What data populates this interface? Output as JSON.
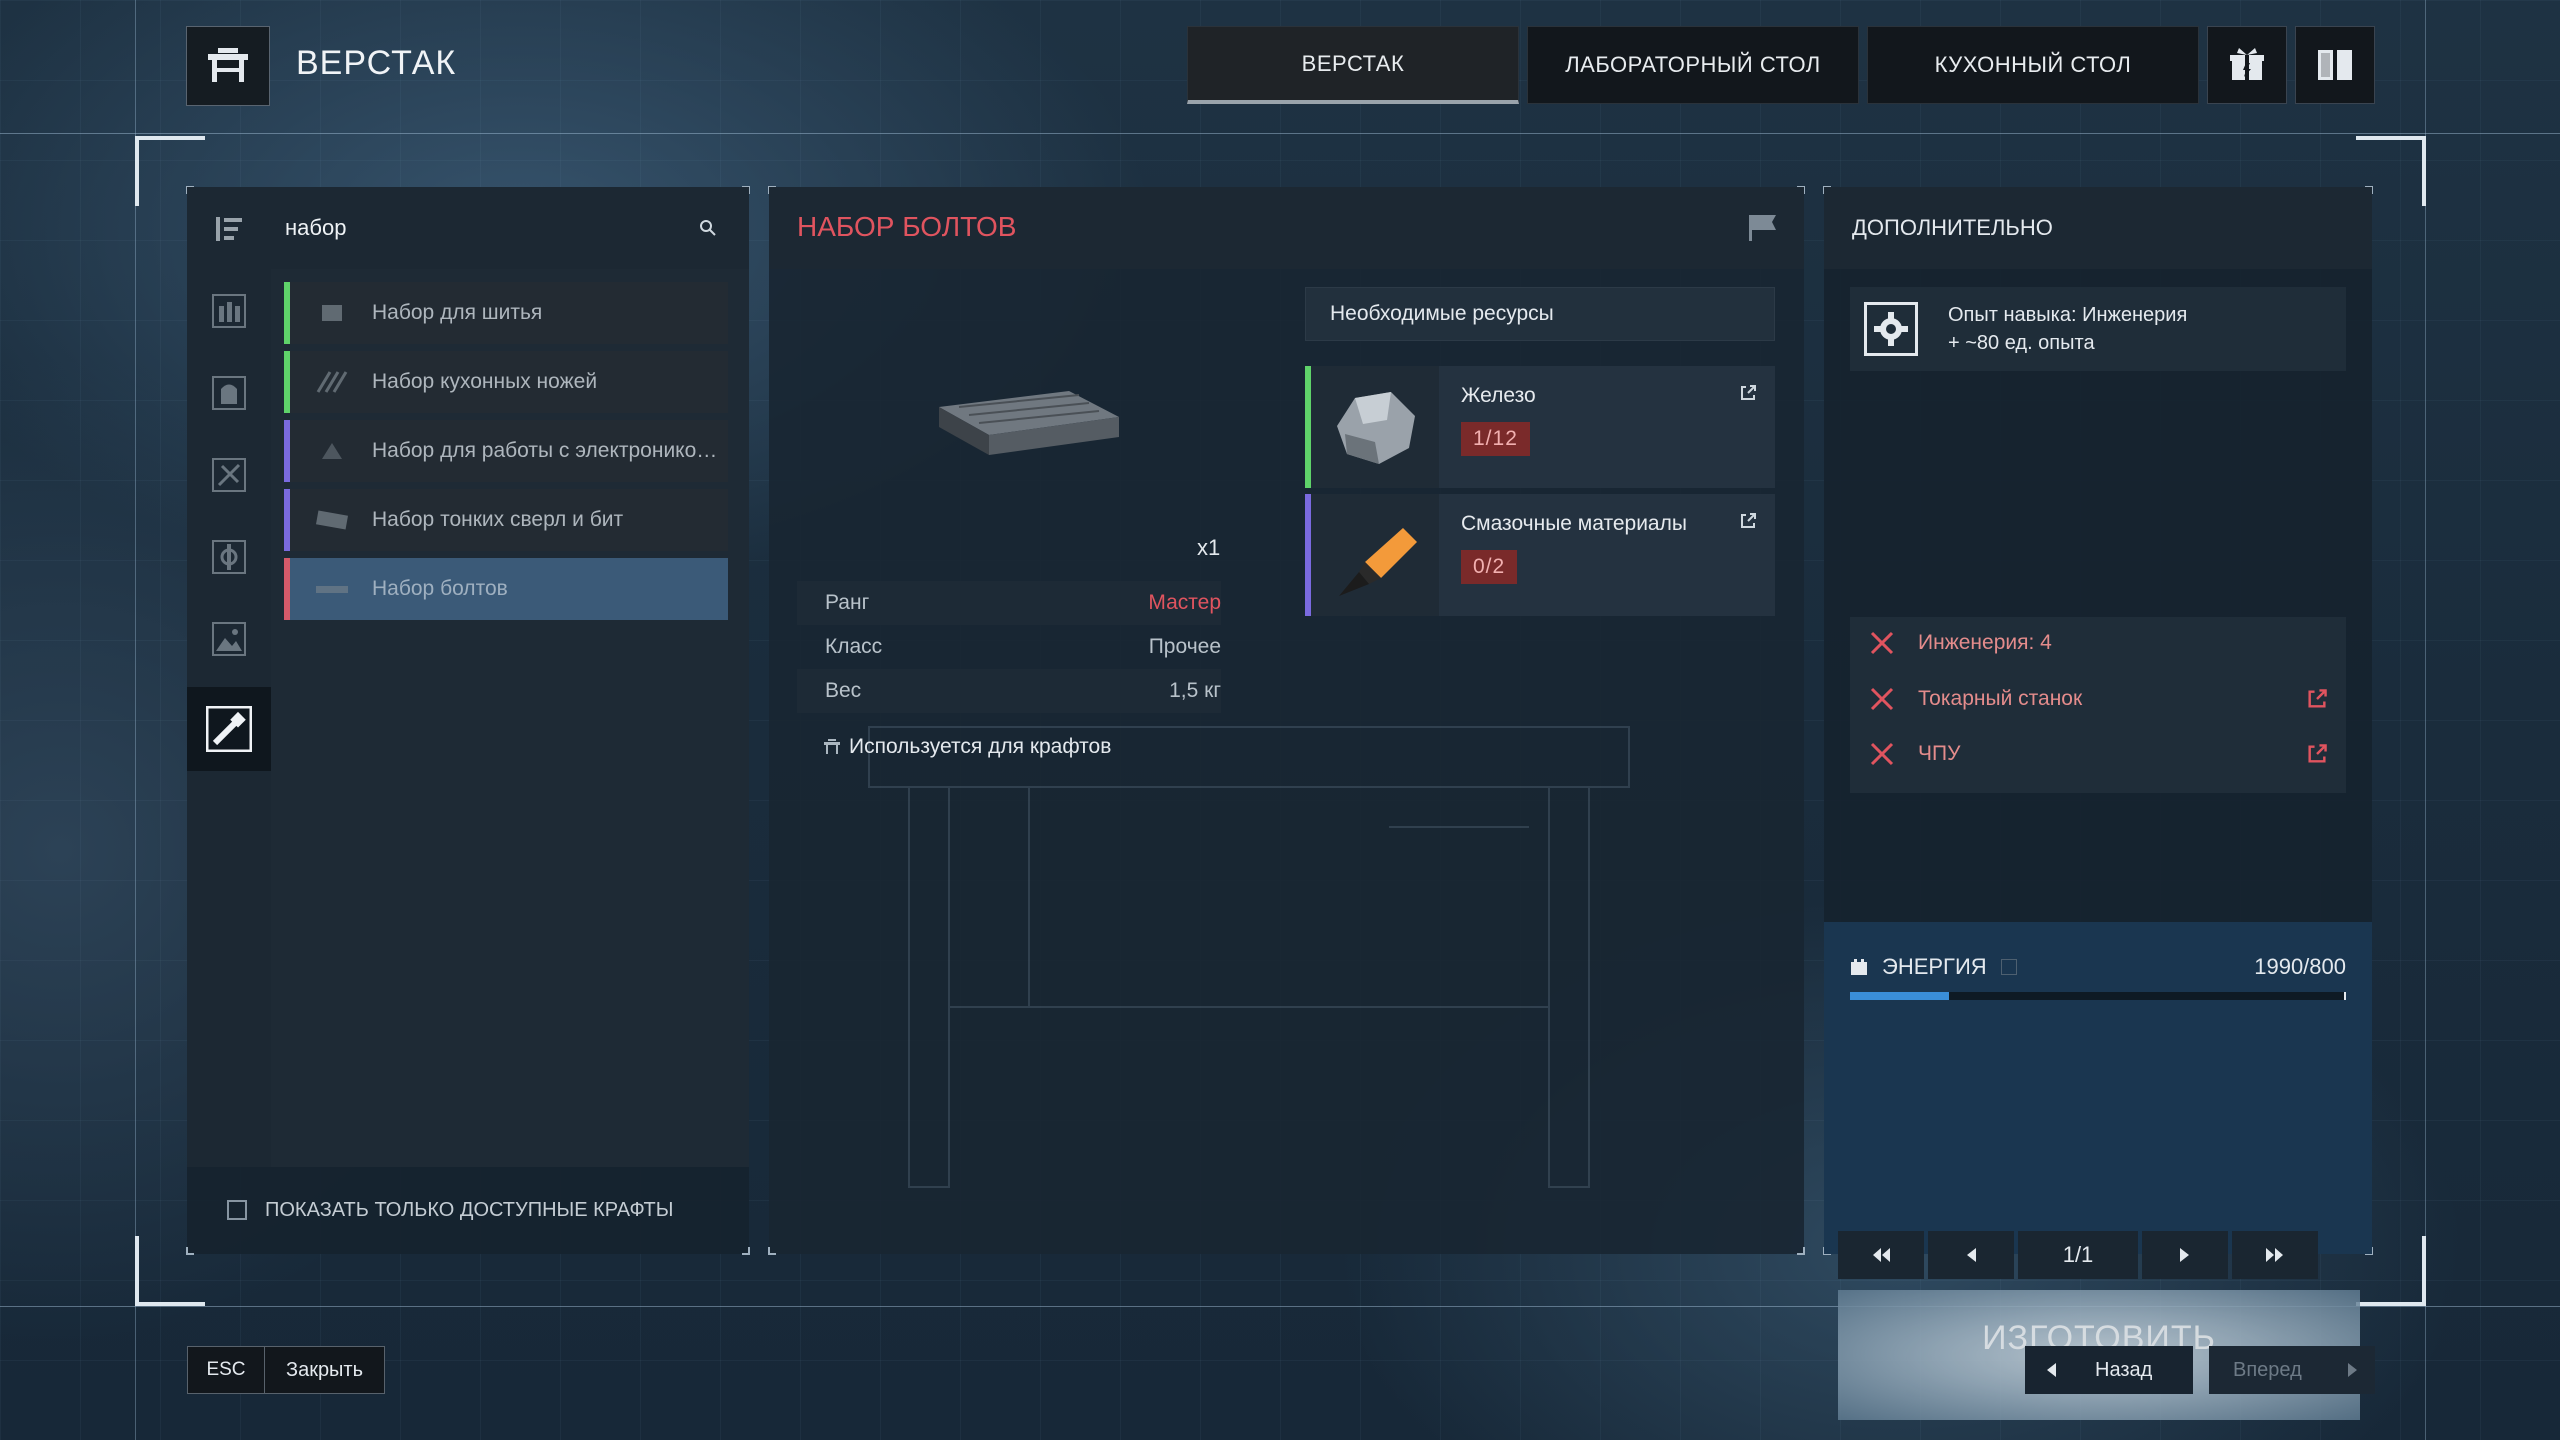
{
  "header": {
    "title": "ВЕРСТАК",
    "tabs": [
      "ВЕРСТАК",
      "ЛАБОРАТОРНЫЙ СТОЛ",
      "КУХОННЫЙ СТОЛ"
    ],
    "active_tab": 0
  },
  "left": {
    "search_value": "набор",
    "items": [
      {
        "label": "Набор для шитья",
        "bar_color": "#5fd36a"
      },
      {
        "label": "Набор кухонных ножей",
        "bar_color": "#5fd36a"
      },
      {
        "label": "Набор для работы с электроникой…",
        "bar_color": "#7a6adf"
      },
      {
        "label": "Набор тонких сверл и бит",
        "bar_color": "#7a6adf"
      },
      {
        "label": "Набор болтов",
        "bar_color": "#d55a6a"
      }
    ],
    "selected_index": 4,
    "filter_label": "ПОКАЗАТЬ ТОЛЬКО ДОСТУПНЫЕ КРАФТЫ",
    "filter_checked": false
  },
  "center": {
    "title": "НАБОР БОЛТОВ",
    "quantity": "x1",
    "stats": [
      {
        "label": "Ранг",
        "value": "Мастер"
      },
      {
        "label": "Класс",
        "value": "Прочее"
      },
      {
        "label": "Вес",
        "value": "1,5 кг"
      }
    ],
    "used_for": "Используется для крафтов",
    "resources_header": "Необходимые ресурсы",
    "resources": [
      {
        "name": "Железо",
        "count": "1/12",
        "bar_color": "#5fd36a",
        "icon": "iron-ore-icon"
      },
      {
        "name": "Смазочные материалы",
        "count": "0/2",
        "bar_color": "#7a6adf",
        "icon": "lubricant-icon"
      }
    ]
  },
  "right": {
    "title": "ДОПОЛНИТЕЛЬНО",
    "xp_label": "Опыт навыка: Инженерия",
    "xp_value": "+ ~80 ед. опыта",
    "requirements": [
      {
        "label": "Инженерия: 4",
        "link": false
      },
      {
        "label": "Токарный станок",
        "link": true
      },
      {
        "label": "ЧПУ",
        "link": true
      }
    ],
    "energy_label": "ЭНЕРГИЯ",
    "energy_value": "1990/800",
    "energy_fill": 0.2,
    "pager": "1/1",
    "craft_label": "ИЗГОТОВИТЬ",
    "craft_cost": "800"
  },
  "footer": {
    "esc_key": "ESC",
    "close_label": "Закрыть",
    "back_label": "Назад",
    "forward_label": "Вперед"
  },
  "colors": {
    "accent_red": "#e0545f",
    "energy_blue": "#3a8ed8",
    "count_bg": "#7a2a2a"
  }
}
